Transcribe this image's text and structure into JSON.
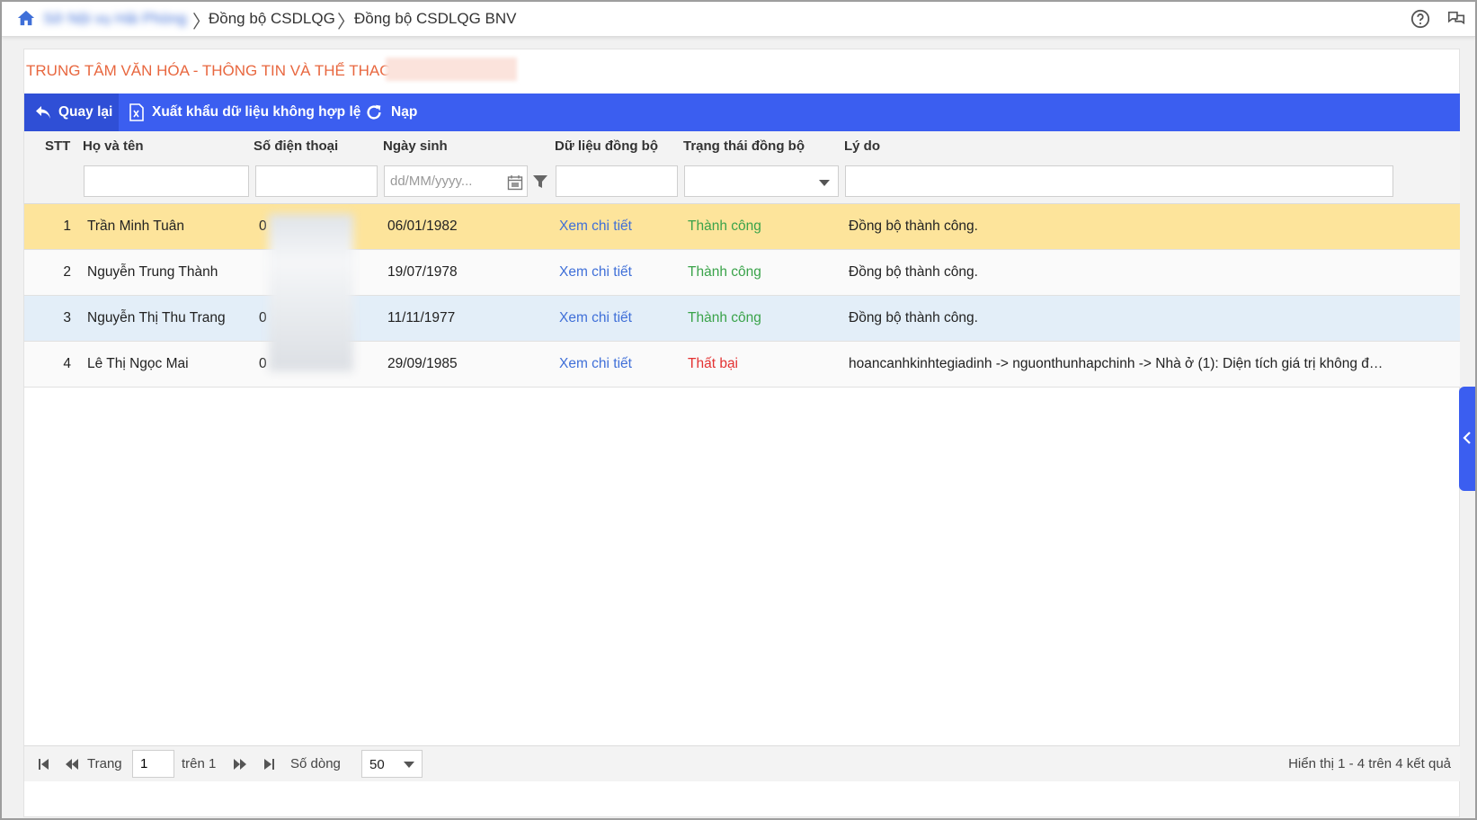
{
  "breadcrumb": {
    "home_icon": "home-icon",
    "root_label": "Sở Nội vụ Hải Phòng",
    "items": [
      "Đồng bộ CSDLQG",
      "Đồng bộ CSDLQG BNV"
    ]
  },
  "header_icons": [
    "help-icon",
    "chat-icon"
  ],
  "organization": {
    "title": "TRUNG TÂM VĂN HÓA - THÔNG TIN VÀ THỂ THAO"
  },
  "toolbar": {
    "back_label": "Quay lại",
    "export_label": "Xuất khẩu dữ liệu không hợp lệ",
    "reload_label": "Nạp"
  },
  "table": {
    "columns": {
      "stt": "STT",
      "name": "Họ và tên",
      "phone": "Số điện thoại",
      "dob": "Ngày sinh",
      "sync_data": "Dữ liệu đồng bộ",
      "sync_status": "Trạng thái đồng bộ",
      "reason": "Lý do"
    },
    "filters": {
      "dob_placeholder": "dd/MM/yyyy..."
    },
    "rows": [
      {
        "stt": "1",
        "name": "Trần Minh Tuân",
        "phone": "0",
        "dob": "06/01/1982",
        "detail": "Xem chi tiết",
        "status": "Thành công",
        "reason": "Đồng bộ thành công."
      },
      {
        "stt": "2",
        "name": "Nguyễn Trung Thành",
        "phone": "",
        "dob": "19/07/1978",
        "detail": "Xem chi tiết",
        "status": "Thành công",
        "reason": "Đồng bộ thành công."
      },
      {
        "stt": "3",
        "name": "Nguyễn Thị Thu Trang",
        "phone": "0",
        "dob": "11/11/1977",
        "detail": "Xem chi tiết",
        "status": "Thành công",
        "reason": "Đồng bộ thành công."
      },
      {
        "stt": "4",
        "name": "Lê Thị Ngọc Mai",
        "phone": "0",
        "dob": "29/09/1985",
        "detail": "Xem chi tiết",
        "status": "Thất bại",
        "reason": "hoancanhkinhtegiadinh -> nguonthunhapchinh -> Nhà ở (1): Diện tích giá trị không đư..."
      }
    ]
  },
  "pager": {
    "page_label": "Trang",
    "page_value": "1",
    "of_label": "trên 1",
    "rows_label": "Số dòng",
    "rows_value": "50",
    "summary": "Hiển thị 1 - 4 trên 4 kết quả"
  },
  "colors": {
    "toolbar": "#3b5ef0",
    "toolbar_active": "#2f4fd6",
    "org_title": "#e8673f",
    "selected_row": "#fde49b",
    "hover_row": "#e3eef8",
    "success": "#3aa34a",
    "failure": "#e33232",
    "link": "#3f6fd8"
  }
}
